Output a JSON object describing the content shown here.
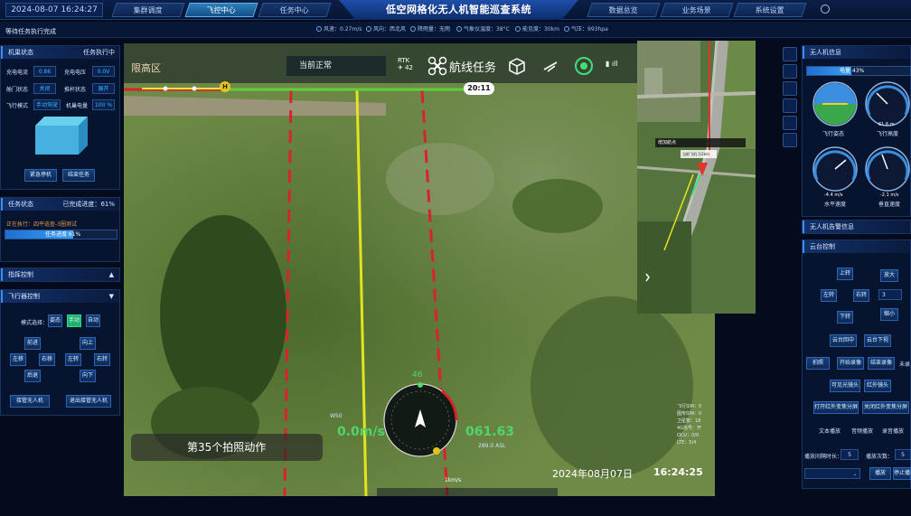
{
  "header": {
    "datetime": "2024-08-07 16:24:27",
    "tabs_left": [
      "集群调度",
      "飞控中心",
      "任务中心"
    ],
    "active_tab": "飞控中心",
    "title": "低空网格化无人机智能巡查系统",
    "tabs_right": [
      "数据总览",
      "业务场景",
      "系统设置"
    ]
  },
  "weather": [
    "风速：0.27m/s",
    "风向：西北风",
    "降雨量：无雨",
    "气象仪温度：38°C",
    "能见度：30km",
    "气压：993hpa"
  ],
  "left": {
    "status_line": "等待任务执行完成",
    "status_title": "机巢状态",
    "status_state": "任务执行中",
    "fields": [
      [
        "充电电流",
        "0.86"
      ],
      [
        "充电电压",
        "0.0V"
      ],
      [
        "舱门状态",
        "关闭"
      ],
      [
        "推杆状态",
        "展开"
      ],
      [
        "飞行模式",
        "手动驾驶"
      ],
      [
        "机巢电量",
        "100 %"
      ]
    ],
    "nest_buttons": [
      "紧急停机",
      "结束任务"
    ],
    "task_title": "任务状态",
    "task_progress_label": "已完成进度：",
    "task_progress_value": "61%",
    "task_progress": 0.61,
    "task_desc": "正在执行：四平巡查-3圈测试",
    "task_bar_text": "任务进度 61%",
    "gimbal_title": "指挥控制",
    "flight_title": "飞行器控制",
    "mode_label": "模式选择：",
    "modes": [
      "姿态",
      "手动",
      "自动"
    ],
    "active_mode": "手动",
    "dir_left": [
      "前进",
      "左移",
      "右移",
      "后退"
    ],
    "dir_right": [
      "向上",
      "左转",
      "右转",
      "向下"
    ],
    "bottom_buttons": [
      "接管无人机",
      "退出接管无人机"
    ]
  },
  "video": {
    "zone": "限高区",
    "status": "当前正常",
    "rtk": "RTK",
    "rtk_num": "42",
    "mission": "航线任务",
    "time_badge": "20:11",
    "caption": "第35个拍照动作",
    "speed_left": "0.0m/s",
    "speed_right": "061.63",
    "alt": "289.0 ASL",
    "heading_num": "46",
    "heading_left": "WS0",
    "dist": "1km/s",
    "osd_date": "2024年08月07日",
    "osd_time": "16:24:25",
    "stats": [
      "飞行SIM：0",
      "图传SIM：0",
      "卫星数：18",
      "4G信号：开",
      "OCU：0/0",
      "LTE：5/4"
    ],
    "h_marker": "H"
  },
  "map": {
    "tag": "增加航点",
    "plane_label": "当前飞机 1/2km"
  },
  "right": {
    "info_title": "无人机信息",
    "battery_text": "电量 43%",
    "battery": 0.43,
    "gauges": [
      {
        "label": "飞行姿态",
        "value": ""
      },
      {
        "label": "飞行高度",
        "value": "61.6 m"
      },
      {
        "label": "水平速度",
        "value": "-4.4 m/s"
      },
      {
        "label": "垂直速度",
        "value": "-2.1 m/s"
      }
    ],
    "alarm_title": "无人机告警信息",
    "gimbal_title": "云台控制",
    "up": "上转",
    "left": "左转",
    "right": "右转",
    "down": "下转",
    "zoom_in": "放大",
    "zoom_out": "缩小",
    "zoom_val": "3",
    "center": "云台回中",
    "pitch_down": "云台下视",
    "photo": "拍照",
    "rec_start": "开始录像",
    "rec_stop": "结束录像",
    "unrec": "未录",
    "visible": "可见光镜头",
    "ir": "红外镜头",
    "open_ir": "打开红外变焦分屏",
    "close_ir": "关闭红外变焦分屏",
    "play_text": "文本播放",
    "play_audio": "音频播放",
    "rec_audio": "录音播放",
    "count_label": "播放间隔时长：",
    "count_val": "5",
    "times_label": "播放次数：",
    "times_val": "5",
    "play": "播放",
    "stop": "停止播"
  }
}
